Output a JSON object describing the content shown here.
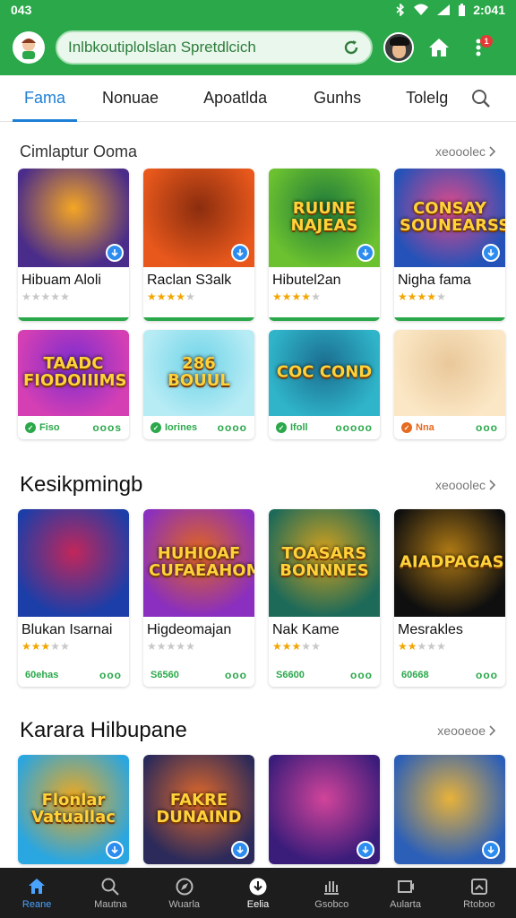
{
  "status": {
    "time": "043",
    "clock": "2:041"
  },
  "header": {
    "search_value": "",
    "search_placeholder": "Inlbkoutiplolslan Spretdlcich",
    "notification_count": "1"
  },
  "tabs": [
    {
      "label": "Fama",
      "active": true
    },
    {
      "label": "Nonuae"
    },
    {
      "label": "Apoatlda"
    },
    {
      "label": "Gunhs"
    },
    {
      "label": "Tolelg"
    }
  ],
  "sections": [
    {
      "title": "Cimlaptur Ooma",
      "see_all": "xeooolec",
      "cards": [
        {
          "name": "Hibuam Aloli",
          "thumb_text": "",
          "rating": 0,
          "colors": [
            "#4a2c8a",
            "#f5a623"
          ]
        },
        {
          "name": "Raclan S3alk",
          "thumb_text": "",
          "rating": 4,
          "colors": [
            "#e8581c",
            "#8a2d0e"
          ]
        },
        {
          "name": "Hibutel2an",
          "thumb_text": "RUUNE NAJEAS",
          "rating": 4,
          "colors": [
            "#6bc12f",
            "#1f7a3a"
          ]
        },
        {
          "name": "Nigha fama",
          "thumb_text": "CONSAY SOUNEARSS",
          "rating": 4,
          "colors": [
            "#2552b8",
            "#e04a8a"
          ]
        }
      ],
      "row2": [
        {
          "thumb_text": "TAADC FIODOIIIMS",
          "tag": "Fiso",
          "dots": "ooos",
          "colors": [
            "#d43fb4",
            "#7b2ccf"
          ]
        },
        {
          "thumb_text": "286 BOUUL",
          "tag": "Iorines",
          "dots": "oooo",
          "colors": [
            "#b8ecf5",
            "#6fd4e8"
          ]
        },
        {
          "thumb_text": "COC COND",
          "tag": "Ifoll",
          "dots": "ooooo",
          "colors": [
            "#2fb4c9",
            "#1b6d8f"
          ]
        },
        {
          "thumb_text": "",
          "tag": "Nna",
          "dots": "ooo",
          "colors": [
            "#fbe7c5",
            "#e9c89a"
          ]
        }
      ]
    },
    {
      "title": "Kesikpmingb",
      "see_all": "xeooolec",
      "cards": [
        {
          "name": "Blukan Isarnai",
          "thumb_text": "",
          "rating": 3,
          "price": "60ehas",
          "dots": "ooo",
          "colors": [
            "#1b3ea8",
            "#c2265a"
          ]
        },
        {
          "name": "Higdeomajan",
          "thumb_text": "HUHIOAF CUFAEAHOMN",
          "rating": 0,
          "price": "S6560",
          "dots": "ooo",
          "colors": [
            "#8a2fbf",
            "#e0651e"
          ]
        },
        {
          "name": "Nak Kame",
          "thumb_text": "TOASARS BONNNES",
          "rating": 3,
          "price": "S6600",
          "dots": "ooo",
          "colors": [
            "#1d6a59",
            "#d4a11d"
          ]
        },
        {
          "name": "Mesrakles",
          "thumb_text": "AIADPAGAS",
          "rating": 2,
          "price": "60668",
          "dots": "ooo",
          "colors": [
            "#0f0f0f",
            "#b07a14"
          ]
        }
      ]
    },
    {
      "title": "Karara Hilbupane",
      "see_all": "xeooeoe",
      "cards": [
        {
          "thumb_text": "Flonlar Vatuallac",
          "colors": [
            "#2aa6e0",
            "#f0a81c"
          ]
        },
        {
          "thumb_text": "FAKRE DUNAIND",
          "colors": [
            "#2b2a5a",
            "#e0682a"
          ]
        },
        {
          "thumb_text": "",
          "colors": [
            "#3a1c7a",
            "#d2449a"
          ]
        },
        {
          "thumb_text": "",
          "colors": [
            "#2b5fb8",
            "#e8b23a"
          ]
        }
      ]
    }
  ],
  "bottom_nav": [
    {
      "label": "Reane",
      "icon": "home-icon",
      "active": true
    },
    {
      "label": "Mautna",
      "icon": "search-icon"
    },
    {
      "label": "Wuarla",
      "icon": "compass-icon"
    },
    {
      "label": "Eelia",
      "icon": "download-icon",
      "current": true
    },
    {
      "label": "Gsobco",
      "icon": "library-icon"
    },
    {
      "label": "Aularta",
      "icon": "games-icon"
    },
    {
      "label": "Rtoboo",
      "icon": "profile-icon"
    }
  ]
}
